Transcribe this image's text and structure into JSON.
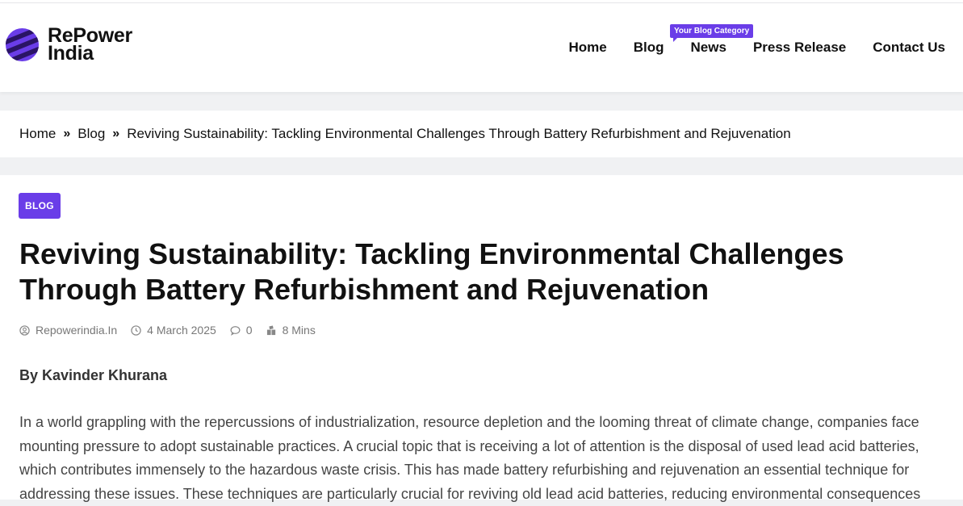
{
  "brand": {
    "line1": "RePower",
    "line2": "India",
    "logo_icon": "globe-stripes-icon",
    "logo_color": "#6a3de8"
  },
  "nav": {
    "items": [
      {
        "label": "Home"
      },
      {
        "label": "Blog"
      },
      {
        "label": "News"
      },
      {
        "label": "Press Release"
      },
      {
        "label": "Contact Us"
      }
    ],
    "badge": "Your Blog Category"
  },
  "breadcrumb": {
    "home": "Home",
    "blog": "Blog",
    "current": "Reviving Sustainability: Tackling Environmental Challenges Through Battery Refurbishment and Rejuvenation",
    "separator": "»"
  },
  "article": {
    "category": "BLOG",
    "title": "Reviving Sustainability: Tackling Environmental Challenges Through Battery Refurbishment and Rejuvenation",
    "meta": {
      "author": "Repowerindia.In",
      "date": "4 March 2025",
      "comments": "0",
      "read_time": "8 Mins"
    },
    "byline": "By Kavinder Khurana",
    "paragraph": "In a world grappling with the repercussions of industrialization, resource depletion and the looming threat of climate change, companies face mounting pressure to adopt sustainable practices. A crucial topic that is receiving a lot of attention is the disposal of used lead acid batteries, which contributes immensely to the hazardous waste crisis. This has made battery refurbishing and rejuvenation an essential technique for addressing these issues. These techniques are particularly crucial for reviving old lead acid batteries, reducing environmental consequences"
  },
  "colors": {
    "accent": "#6a3de8",
    "text": "#111111",
    "muted": "#777777"
  }
}
